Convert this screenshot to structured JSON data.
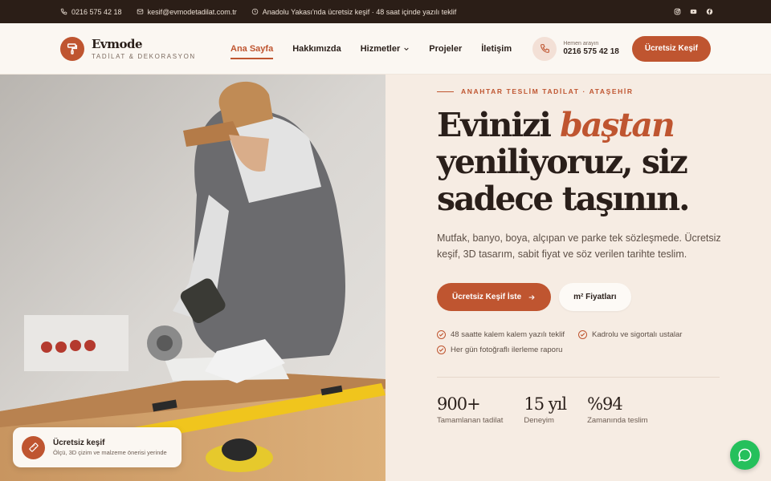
{
  "topbar": {
    "phone": "0216 575 42 18",
    "email": "kesif@evmodetadilat.com.tr",
    "notice": "Anadolu Yakası'nda ücretsiz keşif · 48 saat içinde yazılı teklif",
    "socials": [
      "instagram-icon",
      "youtube-icon",
      "facebook-icon"
    ]
  },
  "header": {
    "brand_name": "Evmode",
    "brand_sub": "TADİLAT & DEKORASYON",
    "nav": [
      {
        "label": "Ana Sayfa",
        "active": true
      },
      {
        "label": "Hakkımızda"
      },
      {
        "label": "Hizmetler",
        "dropdown": true
      },
      {
        "label": "Projeler"
      },
      {
        "label": "İletişim"
      }
    ],
    "call_label": "Hemen arayın",
    "call_number": "0216 575 42 18",
    "cta": "Ücretsiz Keşif"
  },
  "hero": {
    "eyebrow": "ANAHTAR TESLİM TADİLAT · ATAŞEHİR",
    "headline_1": "Evinizi ",
    "headline_accent": "baştan",
    "headline_2": "yeniliyoruz, siz",
    "headline_3": "sadece taşının.",
    "lead": "Mutfak, banyo, boya, alçıpan ve parke tek sözleşmede. Ücretsiz keşif, 3D tasarım, sabit fiyat ve söz verilen tarihte teslim.",
    "primary_btn": "Ücretsiz Keşif İste",
    "secondary_btn": "m² Fiyatları",
    "checks": [
      "48 saatte kalem kalem yazılı teklif",
      "Kadrolu ve sigortalı ustalar",
      "Her gün fotoğraflı ilerleme raporu"
    ],
    "stats": [
      {
        "value": "900+",
        "label": "Tamamlanan tadilat"
      },
      {
        "value": "15 yıl",
        "label": "Deneyim"
      },
      {
        "value": "%94",
        "label": "Zamanında teslim"
      }
    ]
  },
  "float_card": {
    "title": "Ücretsiz keşif",
    "text": "Ölçü, 3D çizim ve malzeme önerisi yerinde"
  },
  "colors": {
    "accent": "#bf5530",
    "topbar_bg": "#2b1e17",
    "page_bg": "#f6ece3",
    "whatsapp": "#25c05c"
  }
}
